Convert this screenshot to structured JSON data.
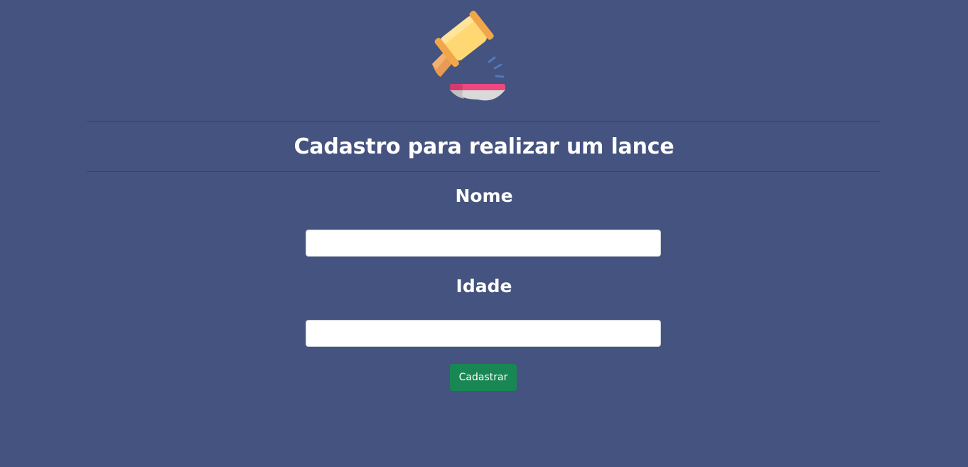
{
  "logo": {
    "icon": "auction-gavel-icon"
  },
  "title": "Cadastro para realizar um lance",
  "form": {
    "nome_label": "Nome",
    "nome_value": "",
    "idade_label": "Idade",
    "idade_value": "",
    "submit_label": "Cadastrar"
  },
  "colors": {
    "background": "#44537f",
    "divider": "#37446b",
    "submit_button": "#198754",
    "text": "#ffffff"
  }
}
